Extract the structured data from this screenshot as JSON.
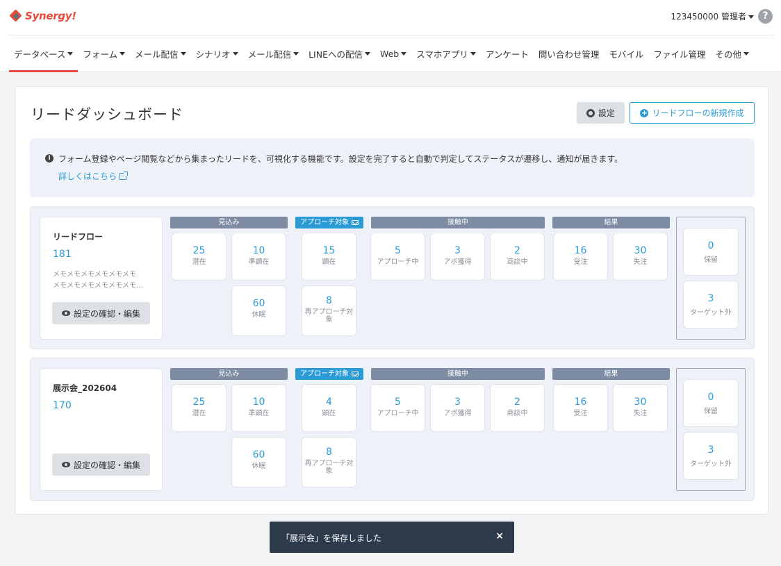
{
  "header": {
    "logo": "Synergy!",
    "account": "123450000 管理者",
    "help": "?"
  },
  "nav": [
    {
      "label": "データベース",
      "dropdown": true,
      "active": true
    },
    {
      "label": "フォーム",
      "dropdown": true
    },
    {
      "label": "メール配信",
      "dropdown": true
    },
    {
      "label": "シナリオ",
      "dropdown": true
    },
    {
      "label": "メール配信",
      "dropdown": true
    },
    {
      "label": "LINEへの配信",
      "dropdown": true
    },
    {
      "label": "Web",
      "dropdown": true
    },
    {
      "label": "スマホアプリ",
      "dropdown": true
    },
    {
      "label": "アンケート",
      "dropdown": false
    },
    {
      "label": "問い合わせ管理",
      "dropdown": false
    },
    {
      "label": "モバイル",
      "dropdown": false
    },
    {
      "label": "ファイル管理",
      "dropdown": false
    },
    {
      "label": "その他",
      "dropdown": true
    }
  ],
  "page": {
    "title": "リードダッシュボード",
    "settings_label": "設定",
    "new_flow_label": "リードフローの新規作成"
  },
  "info": {
    "text": "フォーム登録やページ閲覧などから集まったリードを、可視化する機能です。設定を完了すると自動で判定してステータスが遷移し、通知が届きます。",
    "link": "詳しくはこちら"
  },
  "stages": {
    "prospect": "見込み",
    "approach": "アプローチ対象",
    "contact": "接触中",
    "result": "結果"
  },
  "edit_label": "設定の確認・編集",
  "flows": [
    {
      "name": "リードフロー",
      "count": "181",
      "memo": [
        "メモメモメモメモメモメモ",
        "メモメモメモメモメモメモ…"
      ],
      "prospect": [
        {
          "value": "25",
          "label": "潜在"
        },
        {
          "value": "10",
          "label": "準顕在"
        },
        {
          "value": "60",
          "label": "休眠"
        }
      ],
      "approach": [
        {
          "value": "15",
          "label": "顕在"
        },
        {
          "value": "8",
          "label": "再アプローチ対象"
        }
      ],
      "contact": [
        {
          "value": "5",
          "label": "アプローチ中"
        },
        {
          "value": "3",
          "label": "アポ獲得"
        },
        {
          "value": "2",
          "label": "商談中"
        }
      ],
      "result": [
        {
          "value": "16",
          "label": "受注"
        },
        {
          "value": "30",
          "label": "失注"
        }
      ],
      "side": [
        {
          "value": "0",
          "label": "保留"
        },
        {
          "value": "3",
          "label": "ターゲット外"
        }
      ]
    },
    {
      "name": "展示会_202604",
      "count": "170",
      "memo": [],
      "prospect": [
        {
          "value": "25",
          "label": "潜在"
        },
        {
          "value": "10",
          "label": "準顕在"
        },
        {
          "value": "60",
          "label": "休眠"
        }
      ],
      "approach": [
        {
          "value": "4",
          "label": "顕在"
        },
        {
          "value": "8",
          "label": "再アプローチ対象"
        }
      ],
      "contact": [
        {
          "value": "5",
          "label": "アプローチ中"
        },
        {
          "value": "3",
          "label": "アポ獲得"
        },
        {
          "value": "2",
          "label": "商談中"
        }
      ],
      "result": [
        {
          "value": "16",
          "label": "受注"
        },
        {
          "value": "30",
          "label": "失注"
        }
      ],
      "side": [
        {
          "value": "0",
          "label": "保留"
        },
        {
          "value": "3",
          "label": "ターゲット外"
        }
      ]
    }
  ],
  "toast": {
    "message": "「展示会」を保存しました",
    "close": "×"
  }
}
